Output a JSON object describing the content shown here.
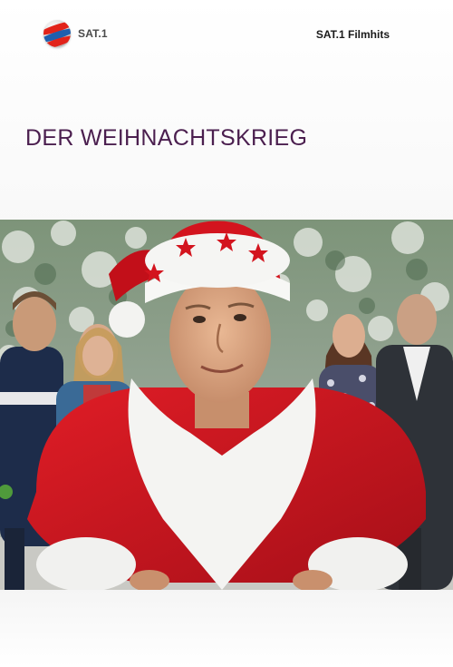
{
  "header": {
    "logo_text": "SAT.1",
    "logo_icon": "sat1-ball-icon",
    "channel_name": "SAT.1 Filmhits"
  },
  "movie": {
    "title": "DER WEIHNACHTSKRIEG"
  },
  "colors": {
    "title": "#4b1f4f",
    "santa_red": "#c8141e",
    "fur_white": "#f4f4f2",
    "tree_green": "#6f8a6a"
  }
}
